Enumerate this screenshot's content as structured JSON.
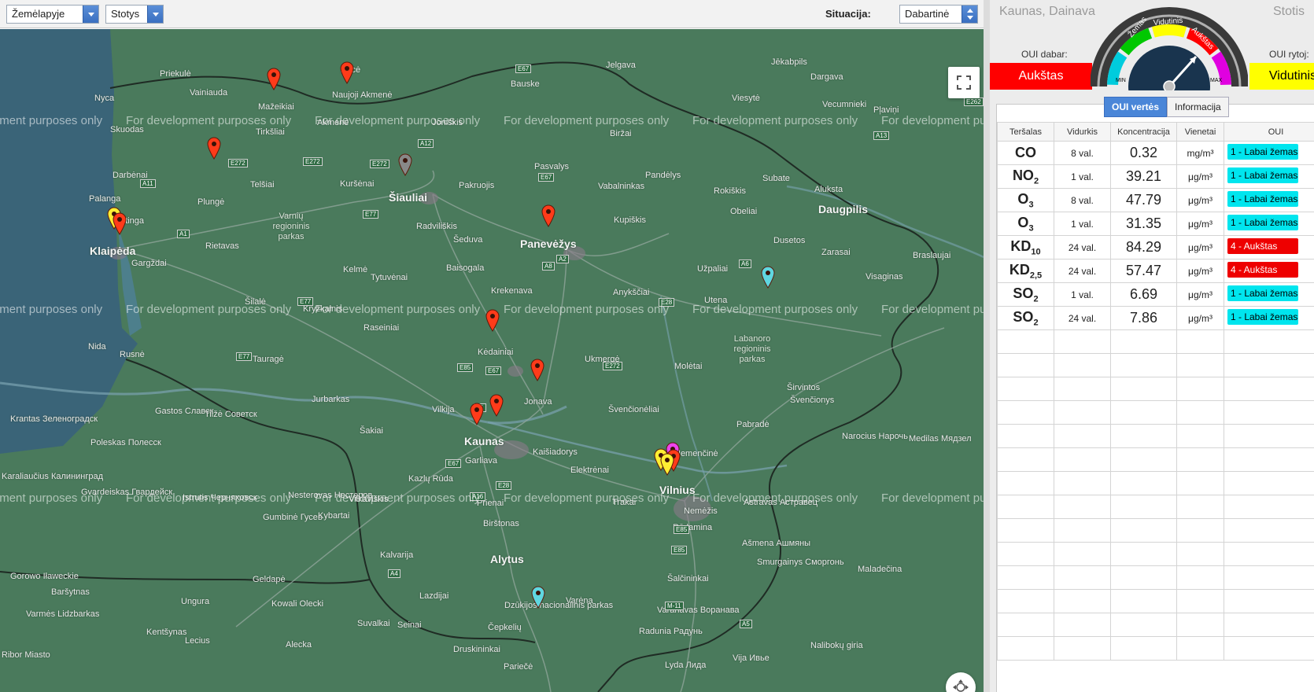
{
  "toolbar": {
    "map_type": "Žemėlapyje",
    "layer": "Stotys",
    "situation_label": "Situacija:",
    "situation_value": "Dabartinė"
  },
  "map": {
    "watermark": "For development purposes only",
    "places_big": [
      "Klaipėda",
      "Šiauliai",
      "Panevėžys",
      "Kaunas",
      "Vilnius",
      "Daugpilis",
      "Alytus"
    ],
    "places": [
      "Priekulė",
      "Vainiauda",
      "Nyca",
      "Mažeikiai",
      "Naujoji Akmenė",
      "Aucė",
      "Bauske",
      "Jelgava",
      "Jēkabpils",
      "Skuodas",
      "Tirkšliai",
      "Akmenė",
      "Joniškis",
      "Biržai",
      "Vecumnieki",
      "Dargava",
      "Viesytė",
      "Pļaviņi",
      "Darbėnai",
      "Telšiai",
      "Kuršėnai",
      "Pasvalys",
      "Pandėlys",
      "Subate",
      "Palanga",
      "Plungė",
      "Pakruojis",
      "Vabalninkas",
      "Rokiškis",
      "Aluksta",
      "Kretinga",
      "Radviliškis",
      "Kupiškis",
      "Obeliai",
      "Rietavas",
      "Gargždai",
      "Šeduva",
      "Dusetos",
      "Zarasai",
      "Baisogala",
      "Užpaliai",
      "Visaginas",
      "Braslaujai",
      "Kelmė",
      "Tytuvėnai",
      "Krekenava",
      "Anykščiai",
      "Utena",
      "Šilalė",
      "Kryžkalnis",
      "Raseiniai",
      "Kėdainiai",
      "Nida",
      "Rusnė",
      "Tauragė",
      "Ukmergė",
      "Molėtai",
      "Jurbarkas",
      "Jonava",
      "Širvintos",
      "Švenčionėliai",
      "Švenčionys",
      "Gastos Славск",
      "Tilžė Советск",
      "Šakiai",
      "Vilkija",
      "Pabradė",
      "Krantas Зеленоградск",
      "Poleskas Полесск",
      "Kaišiadorys",
      "Nemenčinė",
      "Narocius Нарочь",
      "Karaliaučius Калининград",
      "Garliava",
      "Kazlų Rūda",
      "Elektrėnai",
      "Medilas Мядзел",
      "Gvardeiskas Гвардейск",
      "Istrutis Черняховск",
      "Nesterovas Нестеров",
      "Vilkaviškis",
      "Prienai",
      "Trakai",
      "Nemėžis",
      "Astravas Астравец",
      "Gumbinė Гусев",
      "Kybartai",
      "Birštonas",
      "Rūdamina",
      "Ašmena Ашмяны",
      "Smurgainys Сморгонь",
      "Kalvarija",
      "Šalčininkai",
      "Maladečina",
      "Gorowo Iławeckie",
      "Baršytnas",
      "Geldapė",
      "Lazdijai",
      "Varėna",
      "Ungura",
      "Kowali Olecki",
      "Seinai",
      "Varanavas Воранава",
      "Varmės Lidzbarkas",
      "Kentšynas",
      "Suvalkai",
      "Druskininkai",
      "Dzūkijos nacionalinis parkas",
      "Čepkelių",
      "Radunia Радунь",
      "Lecius",
      "Alecka",
      "Nalibokų giria",
      "Vija Ивье",
      "Ribor Miasto",
      "Pariečė",
      "Lyda Лида"
    ],
    "areas": [
      "Varnių regioninis parkas",
      "Labanoro regioninis parkas"
    ],
    "roads": [
      "E272",
      "E272",
      "A11",
      "E272",
      "A12",
      "E67",
      "E67",
      "A1",
      "E77",
      "A2",
      "A8",
      "A6",
      "E262",
      "A13",
      "E77",
      "E85",
      "E67",
      "E272",
      "E28",
      "A1",
      "E67",
      "E85",
      "A16",
      "E28",
      "A4",
      "E85",
      "E77",
      "M-11",
      "A5"
    ]
  },
  "panel": {
    "station_name": "Kaunas, Dainava",
    "station_right": "Stotis",
    "oui_now_label": "OUI dabar:",
    "oui_now_value": "Aukštas",
    "oui_now_color": "#ff0000",
    "oui_tomorrow_label": "OUI rytoj:",
    "oui_tomorrow_value": "Vidutinis",
    "oui_tomorrow_color": "#ffff00",
    "gauge": {
      "labels": [
        "Žemas",
        "Vidutinis",
        "Aukštas"
      ],
      "min_label": "MIN",
      "max_label": "MAX",
      "segment_colors": [
        "#00ccdd",
        "#00c800",
        "#ffff00",
        "#ff0000",
        "#e000e0"
      ],
      "current_level": "Aukštas"
    },
    "tabs": [
      "OUI vertės",
      "Informacija"
    ],
    "active_tab": "OUI vertės",
    "table": {
      "headers": [
        "Teršalas",
        "Vidurkis",
        "Koncentracija",
        "Vienetai",
        "OUI"
      ],
      "rows": [
        {
          "pollutant": "CO",
          "sub": "",
          "avg": "8 val.",
          "conc": "0.32",
          "unit": "mg/m³",
          "oui": "1 - Labai žemas",
          "color": "#00e5ee",
          "text_color": "#000000"
        },
        {
          "pollutant": "NO",
          "sub": "2",
          "avg": "1 val.",
          "conc": "39.21",
          "unit": "μg/m³",
          "oui": "1 - Labai žemas",
          "color": "#00e5ee",
          "text_color": "#000000"
        },
        {
          "pollutant": "O",
          "sub": "3",
          "avg": "8 val.",
          "conc": "47.79",
          "unit": "μg/m³",
          "oui": "1 - Labai žemas",
          "color": "#00e5ee",
          "text_color": "#000000"
        },
        {
          "pollutant": "O",
          "sub": "3",
          "avg": "1 val.",
          "conc": "31.35",
          "unit": "μg/m³",
          "oui": "1 - Labai žemas",
          "color": "#00e5ee",
          "text_color": "#000000"
        },
        {
          "pollutant": "KD",
          "sub": "10",
          "avg": "24 val.",
          "conc": "84.29",
          "unit": "μg/m³",
          "oui": "4 - Aukštas",
          "color": "#ee0000",
          "text_color": "#ffffff"
        },
        {
          "pollutant": "KD",
          "sub": "2,5",
          "avg": "24 val.",
          "conc": "57.47",
          "unit": "μg/m³",
          "oui": "4 - Aukštas",
          "color": "#ee0000",
          "text_color": "#ffffff"
        },
        {
          "pollutant": "SO",
          "sub": "2",
          "avg": "1 val.",
          "conc": "6.69",
          "unit": "μg/m³",
          "oui": "1 - Labai žemas",
          "color": "#00e5ee",
          "text_color": "#000000"
        },
        {
          "pollutant": "SO",
          "sub": "2",
          "avg": "24 val.",
          "conc": "7.86",
          "unit": "μg/m³",
          "oui": "1 - Labai žemas",
          "color": "#00e5ee",
          "text_color": "#000000"
        }
      ],
      "empty_rows": 14
    }
  }
}
